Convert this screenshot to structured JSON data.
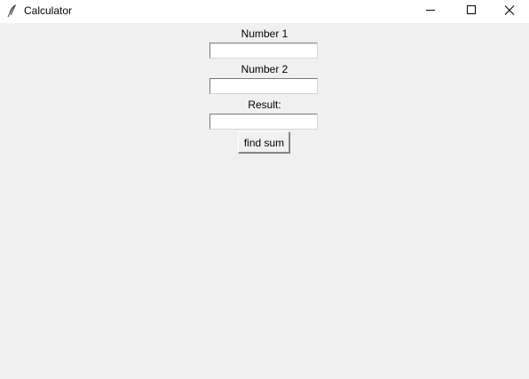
{
  "window": {
    "title": "Calculator",
    "icon": "tk-feather-icon"
  },
  "controls": {
    "minimize_icon": "minimize-icon",
    "maximize_icon": "maximize-icon",
    "close_icon": "close-icon"
  },
  "form": {
    "number1_label": "Number 1",
    "number1_value": "",
    "number2_label": "Number 2",
    "number2_value": "",
    "result_label": "Result:",
    "result_value": "",
    "sum_button_label": "find sum"
  },
  "colors": {
    "background": "#f0f0f0",
    "titlebar": "#ffffff",
    "entry_background": "#ffffff"
  }
}
